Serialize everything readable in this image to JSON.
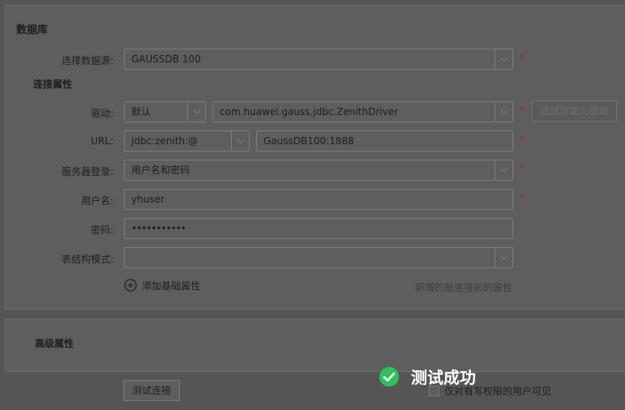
{
  "database_section": {
    "title": "数据库",
    "datasource_label": "选择数据源:",
    "datasource_value": "GAUSSDB 100",
    "required_mark": "*"
  },
  "connection_props": {
    "title": "连接属性",
    "driver_label": "驱动:",
    "driver_type_value": "默认",
    "driver_class_value": "com.huawei.gauss.jdbc.ZenithDriver",
    "custom_driver_button": "选择自定义驱动",
    "url_label": "URL:",
    "url_prefix_value": "jdbc:zenith:@",
    "url_host_value": "GaussDB100:1888",
    "server_login_label": "服务器登录:",
    "server_login_value": "用户名和密码",
    "username_label": "用户名:",
    "username_value": "yhuser",
    "password_label": "密码:",
    "password_value": "•••••••••••",
    "schema_label": "表结构模式:",
    "schema_value": "",
    "add_basic_prop": "添加基础属性",
    "hint_text": "新增的是连接前的属性"
  },
  "advanced_section": {
    "title": "高级属性"
  },
  "footer": {
    "test_button": "测试连接",
    "visibility_checkbox_label": "仅对有写权限的用户可见",
    "visibility_checked": false
  },
  "toast": {
    "message": "测试成功",
    "icon": "check-circle-icon",
    "color": "#2ec25b"
  },
  "colors": {
    "required": "#a8281e",
    "overlay_bg": "#555555"
  }
}
